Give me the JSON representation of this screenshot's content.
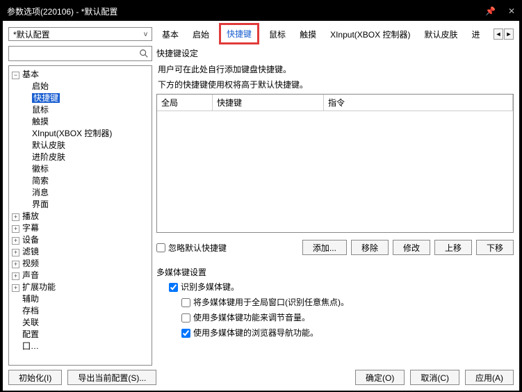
{
  "titlebar": {
    "title": "参数选项(220106) - *默认配置"
  },
  "profile": {
    "selected": "*默认配置"
  },
  "tabs": [
    "基本",
    "启始",
    "快捷键",
    "鼠标",
    "触摸",
    "XInput(XBOX 控制器)",
    "默认皮肤",
    "进"
  ],
  "tree": {
    "basic": {
      "label": "基本",
      "children": [
        "启始",
        "快捷键",
        "鼠标",
        "触摸",
        "XInput(XBOX 控制器)",
        "默认皮肤",
        "进阶皮肤",
        "徽标",
        "简索",
        "消息",
        "界面"
      ]
    },
    "playback": "播放",
    "subtitle": "字幕",
    "device": "设备",
    "filter": "滤镜",
    "video": "视频",
    "audio": "声音",
    "extension": "扩展功能",
    "helper": "辅助",
    "archive": "存档",
    "assoc": "关联",
    "config": "配置",
    "trunc": "囗…"
  },
  "hotkey": {
    "group_title": "快捷键设定",
    "desc1": "用户可在此处自行添加键盘快捷键。",
    "desc2": "下方的快捷键使用权将高于默认快捷键。",
    "columns": [
      "全局",
      "快捷键",
      "指令"
    ],
    "ignore_default": "忽略默认快捷键",
    "buttons": {
      "add": "添加...",
      "remove": "移除",
      "modify": "修改",
      "up": "上移",
      "down": "下移"
    }
  },
  "media": {
    "group_title": "多媒体键设置",
    "recognize": "识别多媒体键。",
    "global_window": "将多媒体键用于全局窗口(识别任意焦点)。",
    "volume": "使用多媒体键功能来调节音量。",
    "browser_nav": "使用多媒体键的浏览器导航功能。"
  },
  "footer": {
    "initialize": "初始化(I)",
    "export": "导出当前配置(S)...",
    "ok": "确定(O)",
    "cancel": "取消(C)",
    "apply": "应用(A)"
  }
}
